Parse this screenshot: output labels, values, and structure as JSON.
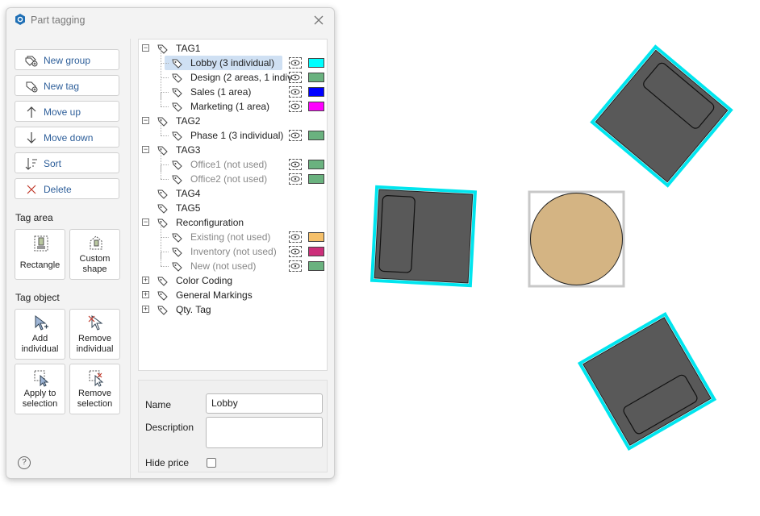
{
  "window": {
    "title": "Part tagging"
  },
  "colors": {
    "accent": "#2e5f9a",
    "selection": "#cfe0f3",
    "highlight": "#00e5ee",
    "desk": "#595959",
    "round_table": "#d4b483"
  },
  "actions": [
    {
      "label": "New group",
      "icon": "new-group-icon"
    },
    {
      "label": "New tag",
      "icon": "new-tag-icon"
    },
    {
      "label": "Move up",
      "icon": "arrow-up-icon"
    },
    {
      "label": "Move down",
      "icon": "arrow-down-icon"
    },
    {
      "label": "Sort",
      "icon": "sort-icon"
    },
    {
      "label": "Delete",
      "icon": "delete-x-icon"
    }
  ],
  "tag_area": {
    "label": "Tag area",
    "rectangle": "Rectangle",
    "custom_shape_l1": "Custom",
    "custom_shape_l2": "shape"
  },
  "tag_object": {
    "label": "Tag object",
    "add_l1": "Add",
    "add_l2": "individual",
    "remove_l1": "Remove",
    "remove_l2": "individual",
    "apply_l1": "Apply to",
    "apply_l2": "selection",
    "remsel_l1": "Remove",
    "remsel_l2": "selection"
  },
  "tree": [
    {
      "level": 0,
      "label": "TAG1",
      "expander": "minus"
    },
    {
      "level": 1,
      "label": "Lobby (3 individual)",
      "color": "#00ffff",
      "selected": true
    },
    {
      "level": 1,
      "label": "Design (2 areas, 1 indiv",
      "color": "#6ab27f"
    },
    {
      "level": 1,
      "label": "Sales (1 area)",
      "color": "#0000ff"
    },
    {
      "level": 1,
      "label": "Marketing (1 area)",
      "color": "#ff00ff"
    },
    {
      "level": 0,
      "label": "TAG2",
      "expander": "minus"
    },
    {
      "level": 1,
      "label": "Phase 1 (3 individual)",
      "color": "#6ab27f"
    },
    {
      "level": 0,
      "label": "TAG3",
      "expander": "minus"
    },
    {
      "level": 1,
      "label": "Office1 (not used)",
      "color": "#6ab27f",
      "unused": true
    },
    {
      "level": 1,
      "label": "Office2 (not used)",
      "color": "#6ab27f",
      "unused": true
    },
    {
      "level": 0,
      "label": "TAG4"
    },
    {
      "level": 0,
      "label": "TAG5"
    },
    {
      "level": 0,
      "label": "Reconfiguration",
      "expander": "minus"
    },
    {
      "level": 1,
      "label": "Existing (not used)",
      "color": "#f5c06a",
      "unused": true
    },
    {
      "level": 1,
      "label": "Inventory (not used)",
      "color": "#cc2f7a",
      "unused": true
    },
    {
      "level": 1,
      "label": "New (not used)",
      "color": "#6ab27f",
      "unused": true
    },
    {
      "level": 0,
      "label": "Color Coding",
      "expander": "plus"
    },
    {
      "level": 0,
      "label": "General Markings",
      "expander": "plus"
    },
    {
      "level": 0,
      "label": "Qty. Tag",
      "expander": "plus"
    }
  ],
  "properties": {
    "name_label": "Name",
    "name_value": "Lobby",
    "description_label": "Description",
    "description_value": "",
    "hide_price_label": "Hide price"
  },
  "help": {
    "glyph": "?"
  }
}
